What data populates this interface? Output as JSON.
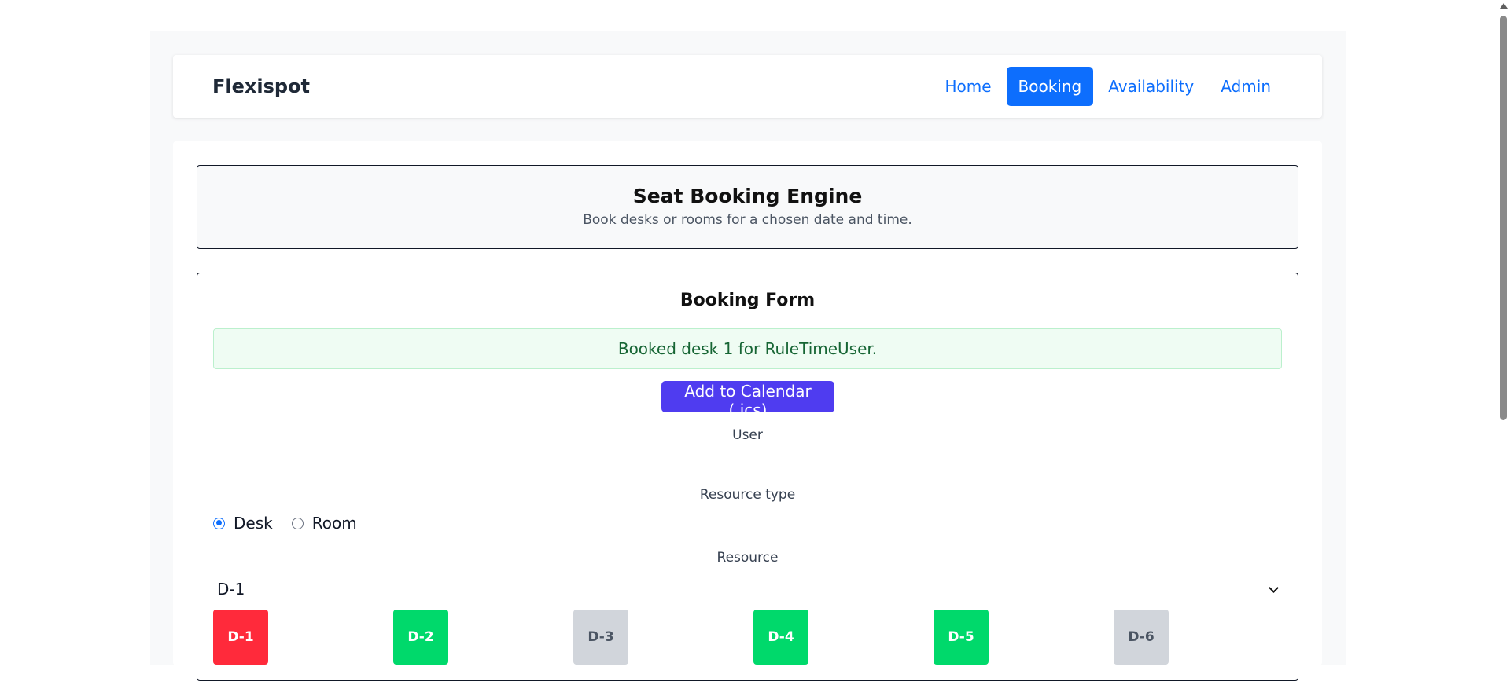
{
  "navbar": {
    "brand": "Flexispot",
    "links": [
      "Home",
      "Booking",
      "Availability",
      "Admin"
    ]
  },
  "header": {
    "title": "Seat Booking Engine",
    "subtitle": "Book desks or rooms for a chosen date and time."
  },
  "form": {
    "title": "Booking Form",
    "alert": "Booked desk 1 for RuleTimeUser.",
    "calendar_button": "Add to Calendar (.ics)",
    "user_label": "User",
    "resource_type_label": "Resource type",
    "resource_types": [
      "Desk",
      "Room"
    ],
    "resource_type_selected": "Desk",
    "resource_label": "Resource",
    "resource_value": "D-1",
    "seats": [
      {
        "label": "D-1",
        "status": "booked"
      },
      {
        "label": "D-2",
        "status": "available"
      },
      {
        "label": "D-3",
        "status": "unavailable"
      },
      {
        "label": "D-4",
        "status": "available"
      },
      {
        "label": "D-5",
        "status": "available"
      },
      {
        "label": "D-6",
        "status": "unavailable"
      }
    ]
  },
  "colors": {
    "primary": "#0d6efd",
    "calendar_button": "#4f3cf0",
    "seat_booked": "#ff2a3b",
    "seat_available": "#00d96b",
    "seat_unavailable": "#d1d5db",
    "alert_bg": "#effcf3",
    "alert_text": "#166534"
  }
}
